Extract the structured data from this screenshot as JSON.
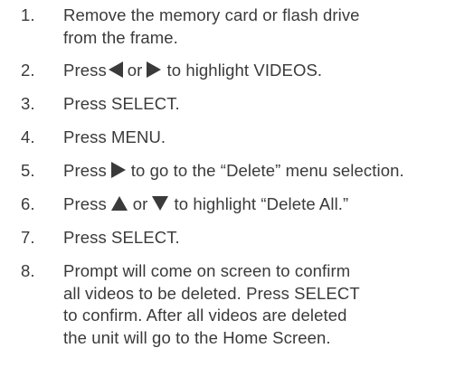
{
  "steps": [
    {
      "number": "1.",
      "lines": [
        "Remove the memory card or flash drive",
        "from the frame."
      ]
    },
    {
      "number": "2.",
      "before": "Press",
      "middle": "or",
      "after": "to highlight VIDEOS.",
      "icon1": "left-triangle-icon",
      "icon2": "right-triangle-icon"
    },
    {
      "number": "3.",
      "text": "Press SELECT."
    },
    {
      "number": "4.",
      "text": "Press MENU."
    },
    {
      "number": "5.",
      "before": "Press",
      "after": "to go to the “Delete” menu selection.",
      "icon1": "right-triangle-icon"
    },
    {
      "number": "6.",
      "before": "Press",
      "middle": "or",
      "after": "to highlight “Delete All.”",
      "icon1": "up-triangle-icon",
      "icon2": "down-triangle-icon"
    },
    {
      "number": "7.",
      "text": "Press SELECT."
    },
    {
      "number": "8.",
      "lines": [
        "Prompt will come on screen to confirm",
        "all videos to be deleted. Press SELECT",
        "to confirm. After all videos are deleted",
        "the unit will go to the Home Screen."
      ]
    }
  ],
  "colors": {
    "text": "#3a3a3a",
    "background": "#ffffff"
  }
}
